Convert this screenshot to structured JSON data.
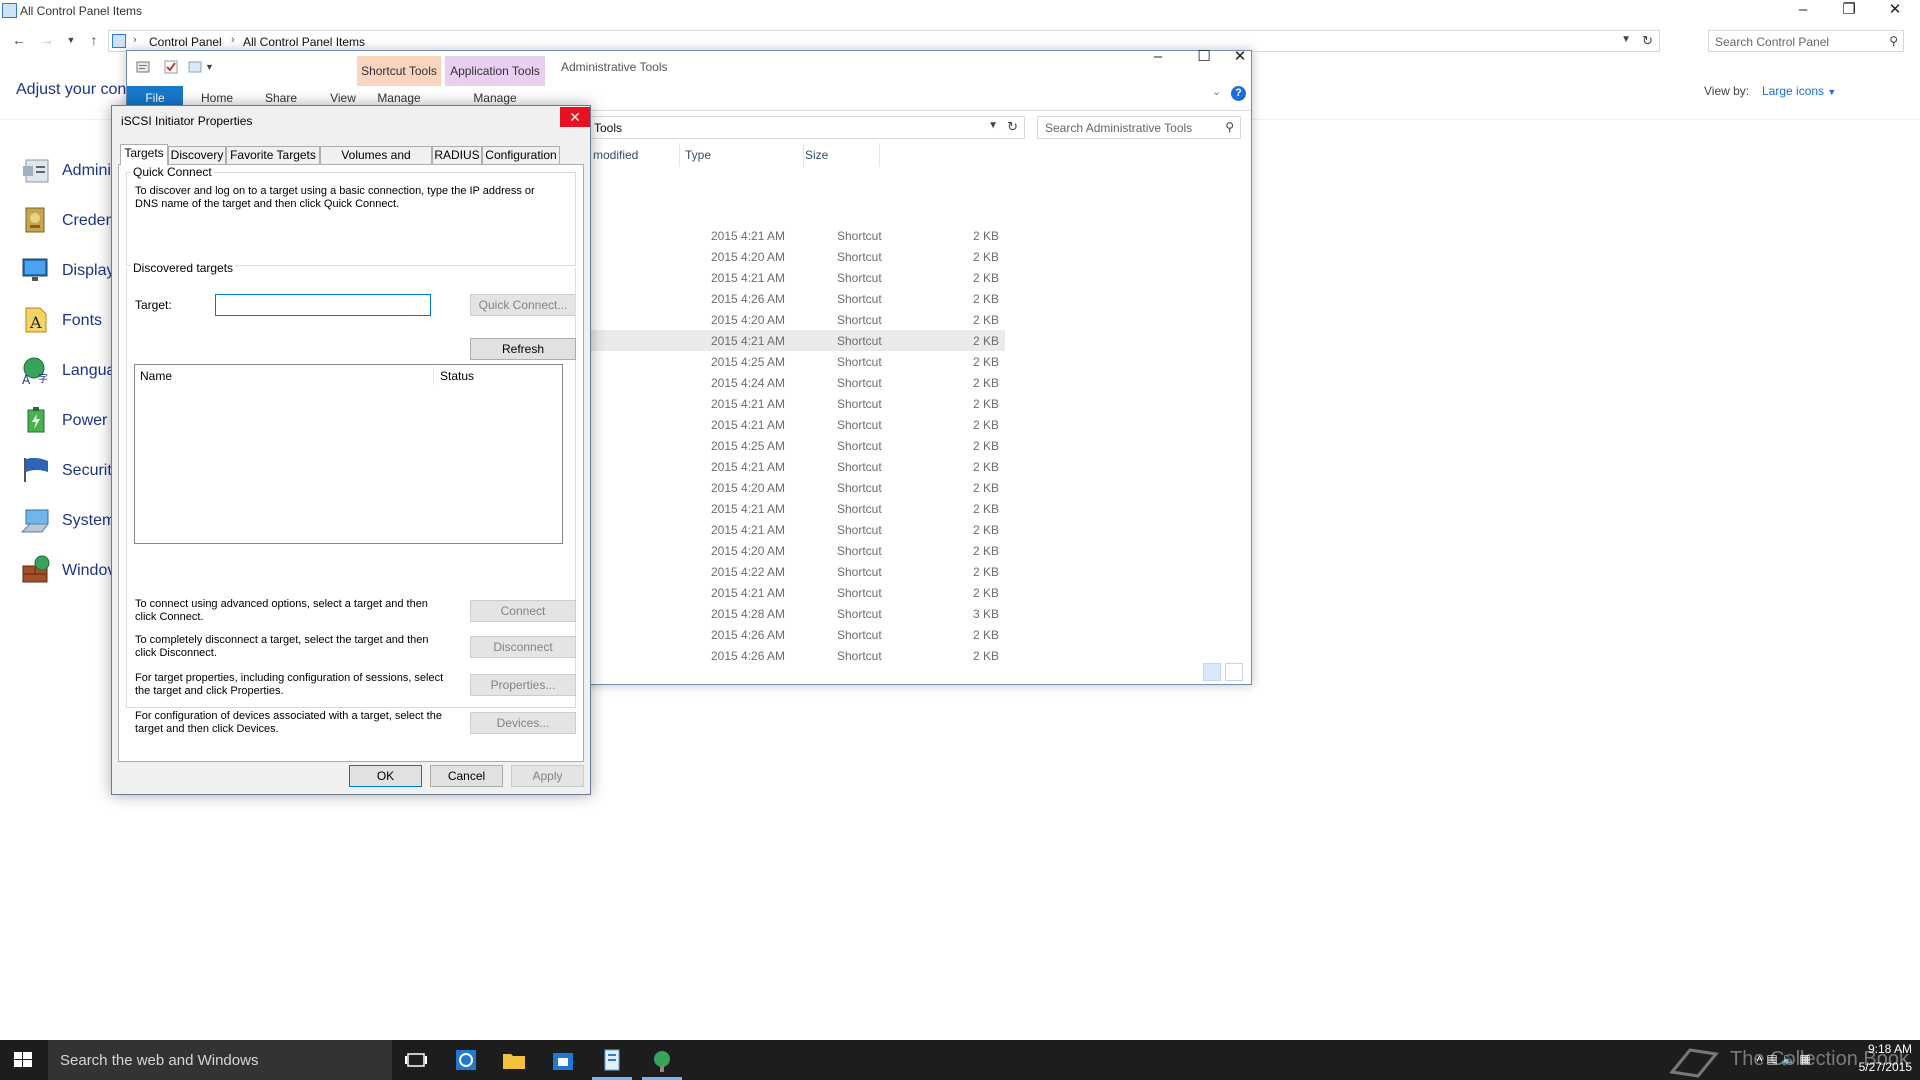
{
  "control_panel": {
    "title": "All Control Panel Items",
    "breadcrumb": [
      "Control Panel",
      "All Control Panel Items"
    ],
    "search_placeholder": "Search Control Panel",
    "heading": "Adjust your con",
    "view_by_label": "View by:",
    "view_by_value": "Large icons",
    "items": [
      {
        "label": "Admini",
        "icon": "admin-tools-icon"
      },
      {
        "label": "Creden",
        "icon": "credential-manager-icon"
      },
      {
        "label": "Display",
        "icon": "display-icon"
      },
      {
        "label": "Fonts",
        "icon": "fonts-icon"
      },
      {
        "label": "Langua",
        "icon": "language-icon"
      },
      {
        "label": "Power (",
        "icon": "power-options-icon"
      },
      {
        "label": "Securit",
        "icon": "security-icon"
      },
      {
        "label": "System",
        "icon": "system-icon"
      },
      {
        "label": "Windov",
        "icon": "firewall-icon"
      }
    ]
  },
  "admin_tools": {
    "title": "Administrative Tools",
    "ribbon_tabs": [
      "File",
      "Home",
      "Share",
      "View"
    ],
    "context_groups": [
      {
        "header": "Shortcut Tools",
        "tab": "Manage"
      },
      {
        "header": "Application Tools",
        "tab": "Manage"
      }
    ],
    "address_crumb": "Tools",
    "search_placeholder": "Search Administrative Tools",
    "columns": [
      "modified",
      "Type",
      "Size"
    ],
    "rows": [
      {
        "date": "2015 4:21 AM",
        "type": "Shortcut",
        "size": "2 KB"
      },
      {
        "date": "2015 4:20 AM",
        "type": "Shortcut",
        "size": "2 KB"
      },
      {
        "date": "2015 4:21 AM",
        "type": "Shortcut",
        "size": "2 KB"
      },
      {
        "date": "2015 4:26 AM",
        "type": "Shortcut",
        "size": "2 KB"
      },
      {
        "date": "2015 4:20 AM",
        "type": "Shortcut",
        "size": "2 KB"
      },
      {
        "date": "2015 4:21 AM",
        "type": "Shortcut",
        "size": "2 KB"
      },
      {
        "date": "2015 4:25 AM",
        "type": "Shortcut",
        "size": "2 KB"
      },
      {
        "date": "2015 4:24 AM",
        "type": "Shortcut",
        "size": "2 KB"
      },
      {
        "date": "2015 4:21 AM",
        "type": "Shortcut",
        "size": "2 KB"
      },
      {
        "date": "2015 4:21 AM",
        "type": "Shortcut",
        "size": "2 KB"
      },
      {
        "date": "2015 4:25 AM",
        "type": "Shortcut",
        "size": "2 KB"
      },
      {
        "date": "2015 4:21 AM",
        "type": "Shortcut",
        "size": "2 KB"
      },
      {
        "date": "2015 4:20 AM",
        "type": "Shortcut",
        "size": "2 KB"
      },
      {
        "date": "2015 4:21 AM",
        "type": "Shortcut",
        "size": "2 KB"
      },
      {
        "date": "2015 4:21 AM",
        "type": "Shortcut",
        "size": "2 KB"
      },
      {
        "date": "2015 4:20 AM",
        "type": "Shortcut",
        "size": "2 KB"
      },
      {
        "date": "2015 4:22 AM",
        "type": "Shortcut",
        "size": "2 KB"
      },
      {
        "date": "2015 4:21 AM",
        "type": "Shortcut",
        "size": "2 KB"
      },
      {
        "date": "2015 4:28 AM",
        "type": "Shortcut",
        "size": "3 KB"
      },
      {
        "date": "2015 4:26 AM",
        "type": "Shortcut",
        "size": "2 KB"
      },
      {
        "date": "2015 4:26 AM",
        "type": "Shortcut",
        "size": "2 KB"
      }
    ],
    "selected_row": 5
  },
  "dialog": {
    "title": "iSCSI Initiator Properties",
    "tabs": [
      "Targets",
      "Discovery",
      "Favorite Targets",
      "Volumes and Devices",
      "RADIUS",
      "Configuration"
    ],
    "active_tab": "Targets",
    "quick_connect": {
      "group_label": "Quick Connect",
      "description": "To discover and log on to a target using a basic connection, type the IP address or DNS name of the target and then click Quick Connect.",
      "target_label": "Target:",
      "target_value": "",
      "button": "Quick Connect..."
    },
    "discovered": {
      "group_label": "Discovered targets",
      "refresh_button": "Refresh",
      "columns": [
        "Name",
        "Status"
      ],
      "actions": [
        {
          "text": "To connect using advanced options, select a target and then click Connect.",
          "button": "Connect"
        },
        {
          "text": "To completely disconnect a target, select the target and then click Disconnect.",
          "button": "Disconnect"
        },
        {
          "text": "For target properties, including configuration of sessions, select the target and click Properties.",
          "button": "Properties..."
        },
        {
          "text": "For configuration of devices associated with a target, select the target and then click Devices.",
          "button": "Devices..."
        }
      ]
    },
    "buttons": {
      "ok": "OK",
      "cancel": "Cancel",
      "apply": "Apply"
    }
  },
  "taskbar": {
    "search_placeholder": "Search the web and Windows",
    "watermark": "The Collection Book",
    "time": "9:18 AM",
    "date": "5/27/2015"
  },
  "colors": {
    "accent": "#1979ca",
    "link": "#1e3287",
    "close_red": "#e81123",
    "taskbar": "#1d1d1d"
  }
}
